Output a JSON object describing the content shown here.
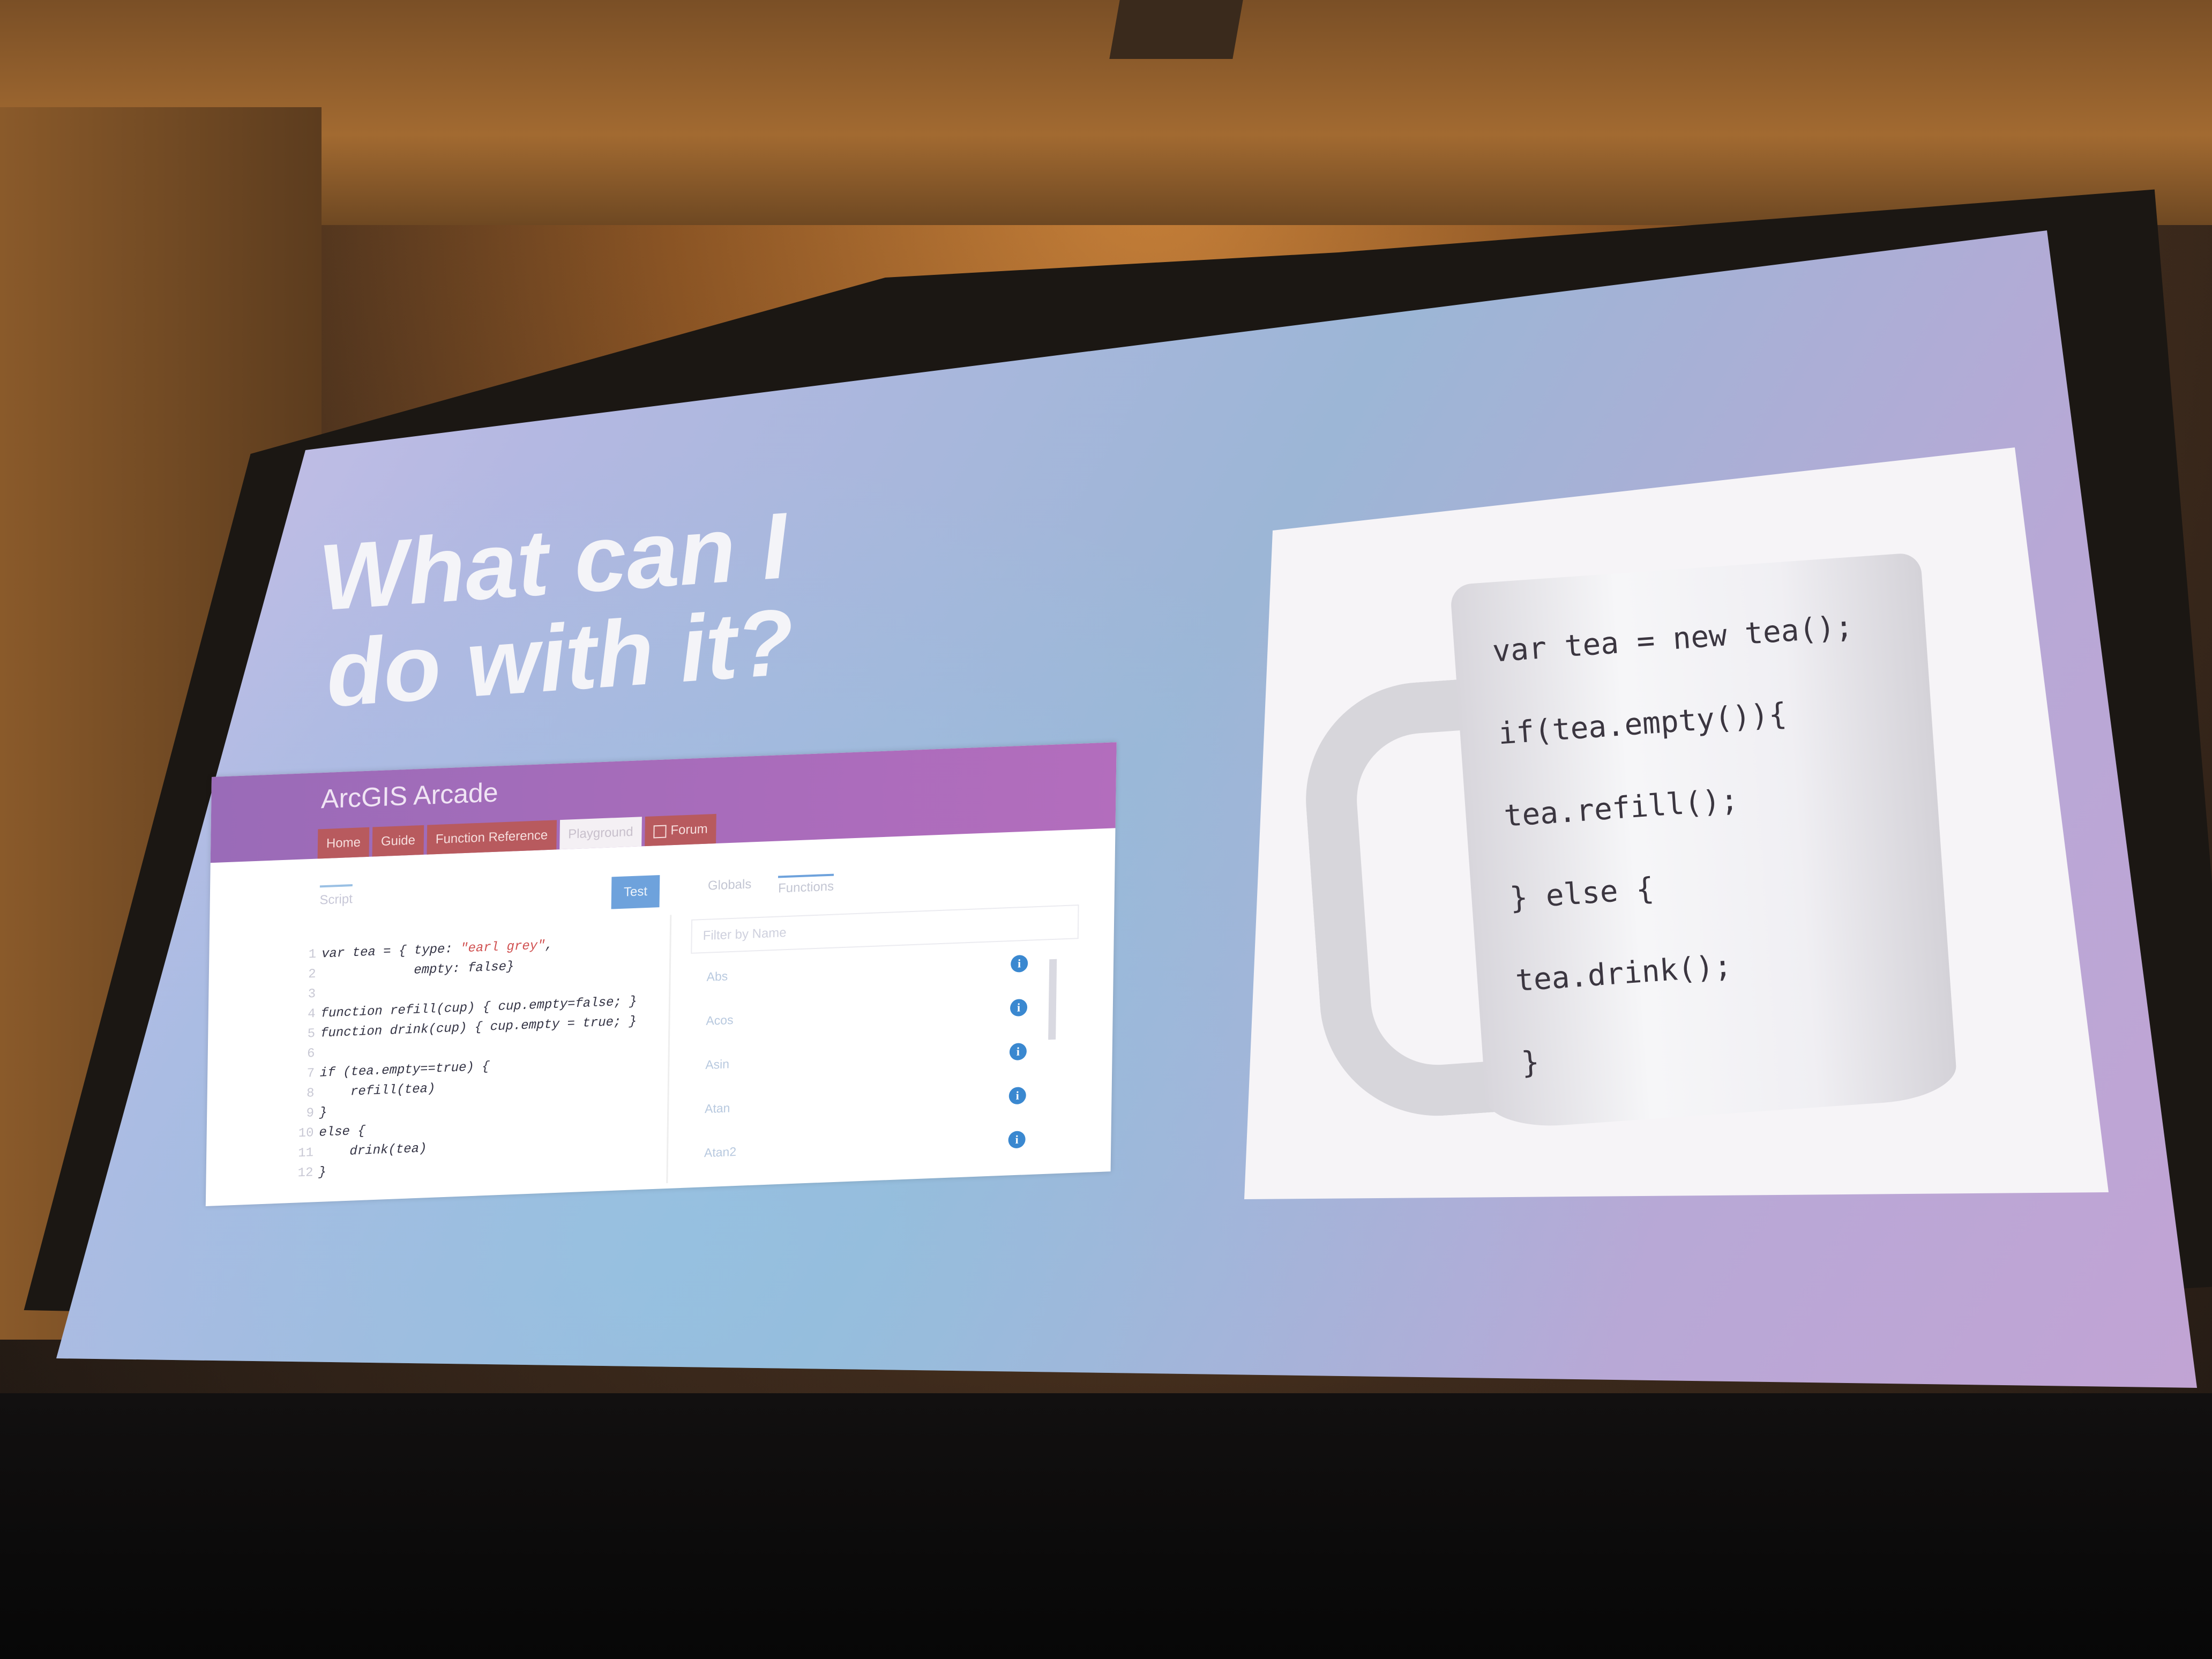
{
  "slide": {
    "title_line1": "What can I",
    "title_line2": "do with it?"
  },
  "arcade_app": {
    "app_title": "ArcGIS Arcade",
    "tabs": [
      {
        "label": "Home"
      },
      {
        "label": "Guide"
      },
      {
        "label": "Function Reference"
      },
      {
        "label": "Playground"
      },
      {
        "label": "Forum"
      }
    ],
    "script_label": "Script",
    "test_button": "Test",
    "side_tabs": [
      "Globals",
      "Functions"
    ],
    "filter_placeholder": "Filter by Name",
    "code_lines": [
      {
        "n": "1",
        "text": "var tea = { type: ",
        "str": "\"earl grey\"",
        "rest": ","
      },
      {
        "n": "2",
        "text": "            empty: false}",
        "str": "",
        "rest": ""
      },
      {
        "n": "3",
        "text": "",
        "str": "",
        "rest": ""
      },
      {
        "n": "4",
        "text": "function refill(cup) { cup.empty=false; }",
        "str": "",
        "rest": ""
      },
      {
        "n": "5",
        "text": "function drink(cup) { cup.empty = true; }",
        "str": "",
        "rest": ""
      },
      {
        "n": "6",
        "text": "",
        "str": "",
        "rest": ""
      },
      {
        "n": "7",
        "text": "if (tea.empty==true) {",
        "str": "",
        "rest": ""
      },
      {
        "n": "8",
        "text": "    refill(tea)",
        "str": "",
        "rest": ""
      },
      {
        "n": "9",
        "text": "}",
        "str": "",
        "rest": ""
      },
      {
        "n": "10",
        "text": "else {",
        "str": "",
        "rest": ""
      },
      {
        "n": "11",
        "text": "    drink(tea)",
        "str": "",
        "rest": ""
      },
      {
        "n": "12",
        "text": "}",
        "str": "",
        "rest": ""
      }
    ],
    "functions": [
      "Abs",
      "Acos",
      "Asin",
      "Atan",
      "Atan2"
    ]
  },
  "mug_code": [
    "var tea = new tea();",
    "if(tea.empty()){",
    "tea.refill();",
    "} else {",
    "tea.drink();",
    "}"
  ]
}
